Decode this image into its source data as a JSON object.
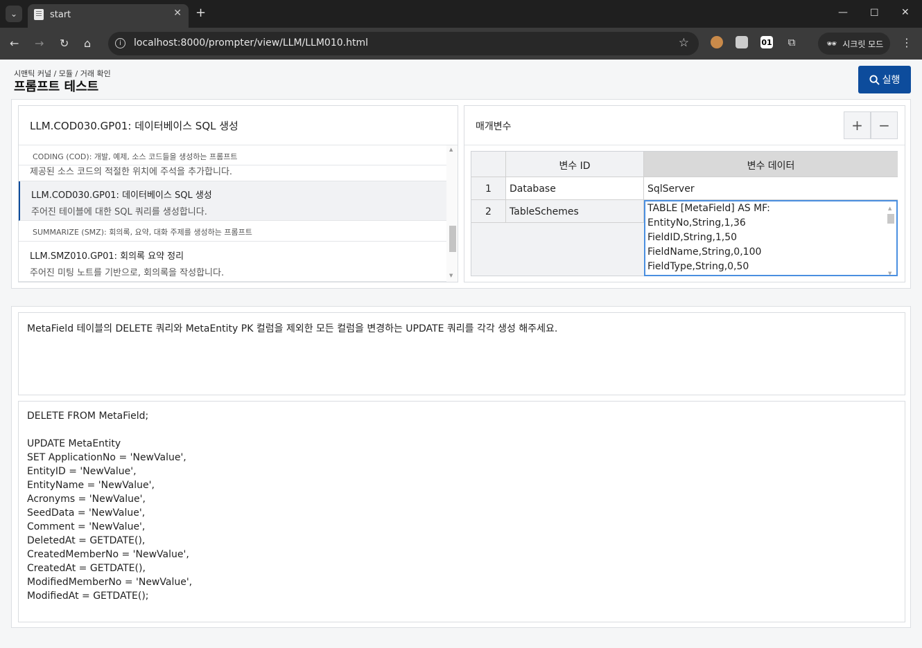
{
  "browser": {
    "tab_title": "start",
    "url": "localhost:8000/prompter/view/LLM/LLM010.html",
    "incognito_label": "시크릿 모드",
    "ext_badge": "01"
  },
  "page": {
    "breadcrumb": "시맨틱 커널 / 모듈 / 거래 확인",
    "title": "프롬프트 테스트",
    "run_label": "실행"
  },
  "left_panel": {
    "header": "LLM.COD030.GP01: 데이터베이스 SQL 생성",
    "groups": [
      {
        "label": "CODING (COD): 개발, 예제, 소스 코드들을 생성하는 프롬프트"
      },
      {
        "label": "SUMMARIZE (SMZ): 회의록, 요약, 대화 주제를 생성하는 프롬프트"
      }
    ],
    "partial_item": "제공된 소스 코드의 적절한 위치에 주석을 추가합니다.",
    "items": [
      {
        "title": "LLM.COD030.GP01: 데이터베이스 SQL 생성",
        "desc": "주어진 테이블에 대한 SQL 쿼리를 생성합니다."
      },
      {
        "title": "LLM.SMZ010.GP01: 회의록 요약 정리",
        "desc": "주어진 미팅 노트를 기반으로, 회의록을 작성합니다."
      }
    ]
  },
  "right_panel": {
    "header": "매개변수",
    "add_label": "+",
    "remove_label": "−",
    "columns": [
      "변수 ID",
      "변수 데이터"
    ],
    "rows": [
      {
        "num": "1",
        "id": "Database",
        "data": "SqlServer"
      },
      {
        "num": "2",
        "id": "TableSchemes",
        "data_lines": [
          "TABLE [MetaField] AS MF:",
          "EntityNo,String,1,36",
          "FieldID,String,1,50",
          "FieldName,String,0,100",
          "FieldType,String,0,50"
        ]
      }
    ]
  },
  "prompt": {
    "text": "MetaField 테이블의 DELETE 쿼리와 MetaEntity PK 컬럼을 제외한 모든 컬럼을 변경하는 UPDATE 쿼리를 각각 생성 해주세요."
  },
  "output": {
    "text": "DELETE FROM MetaField;\n\nUPDATE MetaEntity\nSET ApplicationNo = 'NewValue',\nEntityID = 'NewValue',\nEntityName = 'NewValue',\nAcronyms = 'NewValue',\nSeedData = 'NewValue',\nComment = 'NewValue',\nDeletedAt = GETDATE(),\nCreatedMemberNo = 'NewValue',\nCreatedAt = GETDATE(),\nModifiedMemberNo = 'NewValue',\nModifiedAt = GETDATE();"
  },
  "colors": {
    "accent": "#0d4c9c",
    "focus": "#4a8fe0"
  }
}
